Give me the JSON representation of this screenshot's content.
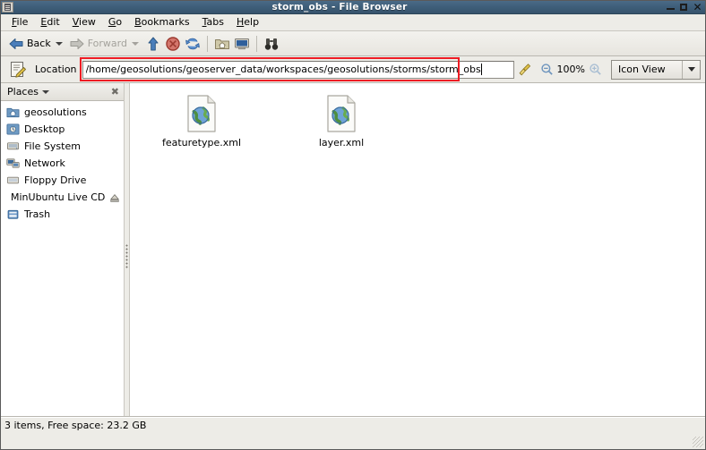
{
  "window": {
    "title": "storm_obs - File Browser",
    "controls": {
      "minimize": "minimize-button",
      "maximize": "maximize-button",
      "close": "✕"
    }
  },
  "menubar": {
    "items": [
      {
        "mnemonic": "F",
        "rest": "ile"
      },
      {
        "mnemonic": "E",
        "rest": "dit"
      },
      {
        "mnemonic": "V",
        "rest": "iew"
      },
      {
        "mnemonic": "G",
        "rest": "o"
      },
      {
        "mnemonic": "B",
        "rest": "ookmarks"
      },
      {
        "mnemonic": "T",
        "rest": "abs"
      },
      {
        "mnemonic": "H",
        "rest": "elp"
      }
    ]
  },
  "toolbar": {
    "back_label": "Back",
    "forward_label": "Forward",
    "icons": [
      "back-arrow-icon",
      "back-dropdown-icon",
      "forward-arrow-icon",
      "forward-dropdown-icon",
      "up-arrow-icon",
      "stop-icon",
      "reload-icon",
      "home-icon",
      "computer-icon",
      "search-icon"
    ]
  },
  "location": {
    "icon": "location-entry-icon",
    "label": "Location",
    "path": "/home/geosolutions/geoserver_data/workspaces/geosolutions/storms/storm_obs",
    "placeholder": "Location",
    "clear_icon": "broom-icon",
    "zoom_out_icon": "zoom-out-icon",
    "zoom_level": "100%",
    "zoom_in_icon": "zoom-in-icon",
    "view_mode": "Icon View",
    "highlight_color": "#ee1c24"
  },
  "sidebar": {
    "header": {
      "title": "Places",
      "caret_icon": "chevron-down-icon",
      "close_icon": "close-icon"
    },
    "items": [
      {
        "label": "geosolutions",
        "icon": "home-folder-icon"
      },
      {
        "label": "Desktop",
        "icon": "desktop-icon"
      },
      {
        "label": "File System",
        "icon": "drive-icon"
      },
      {
        "label": "Network",
        "icon": "network-icon"
      },
      {
        "label": "Floppy Drive",
        "icon": "floppy-drive-icon"
      },
      {
        "label": "MinUbuntu Live CD",
        "icon": "cdrom-icon",
        "eject_icon": "eject-icon"
      },
      {
        "label": "Trash",
        "icon": "trash-icon"
      }
    ]
  },
  "files": [
    {
      "name": "featuretype.xml",
      "icon": "xml-document-icon"
    },
    {
      "name": "layer.xml",
      "icon": "xml-document-icon"
    }
  ],
  "statusbar": {
    "text": "3 items, Free space: 23.2 GB"
  }
}
